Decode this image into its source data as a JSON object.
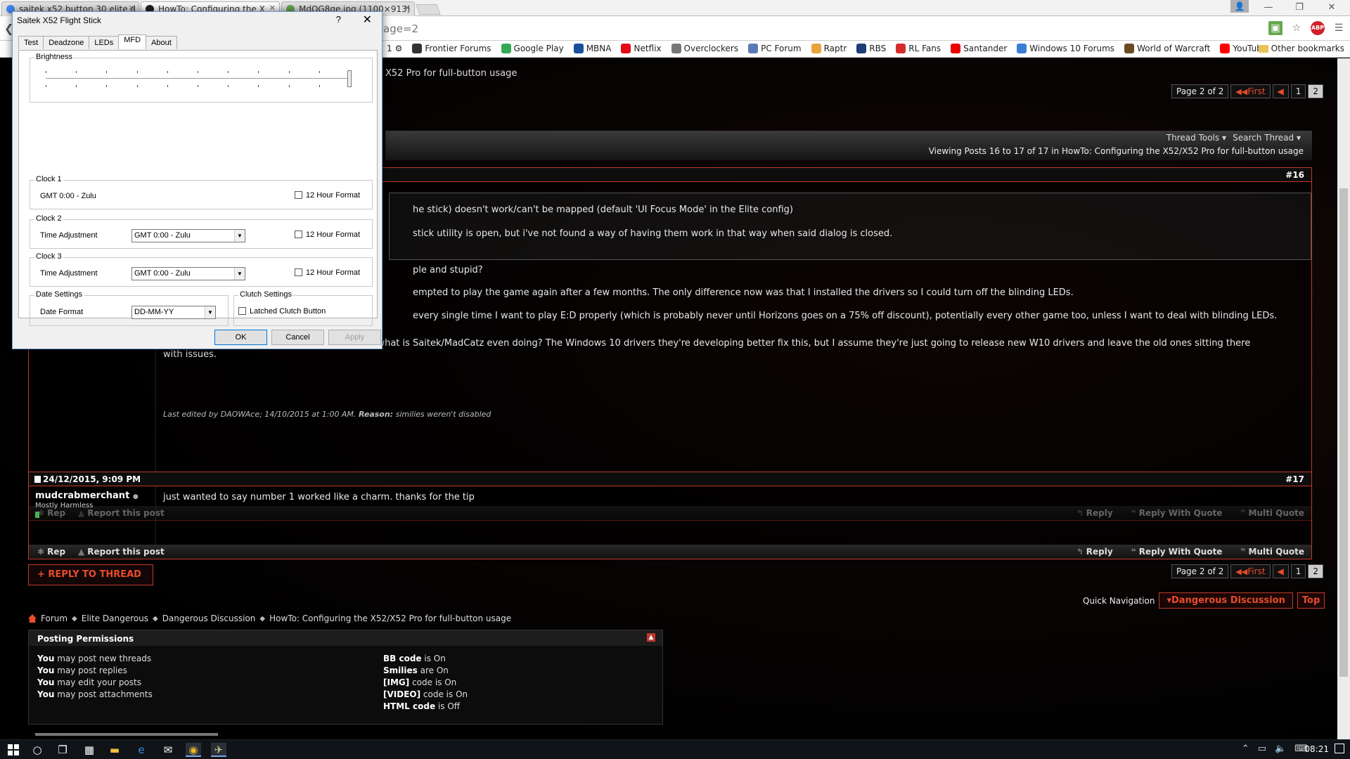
{
  "tabs": [
    {
      "title": "saitek x52 button 30 elite d",
      "color": "#4285f4"
    },
    {
      "title": "HowTo: Configuring the X",
      "color": "#222222"
    },
    {
      "title": "MdOG8ge.jpg (1100×913)",
      "color": "#6aa84f"
    }
  ],
  "url": "age=2",
  "bookmarks": [
    {
      "label": "Frontier Forums",
      "color": "#333333"
    },
    {
      "label": "Google Play",
      "color": "#34a853"
    },
    {
      "label": "MBNA",
      "color": "#1a4f9c"
    },
    {
      "label": "Netflix",
      "color": "#e50914"
    },
    {
      "label": "Overclockers",
      "color": "#777777"
    },
    {
      "label": "PC Forum",
      "color": "#5b7bb8"
    },
    {
      "label": "Raptr",
      "color": "#e8a33c"
    },
    {
      "label": "RBS",
      "color": "#1d3c78"
    },
    {
      "label": "RL Fans",
      "color": "#d62b2b"
    },
    {
      "label": "Santander",
      "color": "#ec0000"
    },
    {
      "label": "Windows 10 Forums",
      "color": "#3a7fd5"
    },
    {
      "label": "World of Warcraft",
      "color": "#6b4b21"
    },
    {
      "label": "YouTube",
      "color": "#ff0000"
    }
  ],
  "bookmark_prefix": "1",
  "other_bookmarks": "Other bookmarks",
  "forum": {
    "thread_title_partial": "X52 Pro for full-button usage",
    "pager": {
      "label": "Page 2 of 2",
      "first": "First",
      "pages": [
        "1",
        "2"
      ],
      "current": "2"
    },
    "thread_tools": "Thread Tools",
    "search_thread": "Search Thread",
    "viewing": "Viewing Posts 16 to 17 of 17 in HowTo: Configuring the X52/X52 Pro for full-button usage",
    "post16": {
      "number": "#16",
      "line1": "he stick) doesn't work/can't be mapped (default 'UI Focus Mode' in the Elite config)",
      "line2": "stick utility is open, but i've not found a way of having them work in that way when said dialog is closed.",
      "line3": "ple and stupid?",
      "line4": "empted to play the game again after a few months. The only difference now was that I installed the drivers so I could turn off the blinding LEDs.",
      "line5": "every single time I want to play E:D properly (which is probably never until Horizons goes on a 75% off discount), potentially every other game too, unless I want to deal with blinding LEDs.",
      "line6": "The drivers haven't been updated since 2013, what is Saitek/MadCatz even doing? The Windows 10 drivers they're developing better fix this, but I assume they're just going to release new W10 drivers and leave the old ones sitting there",
      "line7": "with issues.",
      "edited_prefix": "Last edited by DAOWAce; 14/10/2015 at 1:00 AM.",
      "reason_label": "Reason:",
      "reason_text": "similies weren't disabled"
    },
    "post17": {
      "date": "24/12/2015, 9:09 PM",
      "number": "#17",
      "username": "mudcrabmerchant",
      "rank": "Mostly Harmless",
      "text": "just wanted to say number 1 worked like a charm. thanks for the tip"
    },
    "foot": {
      "rep": "Rep",
      "report": "Report this post",
      "reply": "Reply",
      "reply_quote": "Reply With Quote",
      "multi_quote": "Multi Quote"
    },
    "reply_to_thread": "+ REPLY TO THREAD",
    "quick_nav_label": "Quick Navigation",
    "quick_nav_value": "Dangerous Discussion",
    "top": "Top",
    "breadcrumb": [
      "Forum",
      "Elite Dangerous",
      "Dangerous Discussion",
      "HowTo: Configuring the X52/X52 Pro for full-button usage"
    ],
    "permissions": {
      "title": "Posting Permissions",
      "left": [
        {
          "b": "You",
          "t": "may post new threads"
        },
        {
          "b": "You",
          "t": "may post replies"
        },
        {
          "b": "You",
          "t": "may edit your posts"
        },
        {
          "b": "You",
          "t": "may post attachments"
        }
      ],
      "right": [
        {
          "b": "BB code",
          "t": "is On"
        },
        {
          "b": "Smilies",
          "t": "are On"
        },
        {
          "b": "[IMG]",
          "t": "code is On"
        },
        {
          "b": "[VIDEO]",
          "t": "code is On"
        },
        {
          "b": "HTML code",
          "t": "is Off"
        }
      ]
    }
  },
  "dialog": {
    "title": "Saitek X52 Flight Stick",
    "help": "?",
    "close": "✕",
    "tabs": [
      "Test",
      "Deadzone",
      "LEDs",
      "MFD",
      "About"
    ],
    "active_tab": "MFD",
    "brightness": {
      "label": "Brightness",
      "value": 1.0
    },
    "clock1": {
      "label": "Clock 1",
      "value": "GMT  0:00 - Zulu",
      "hour12": "12 Hour Format"
    },
    "clock2": {
      "label": "Clock 2",
      "adj": "Time Adjustment",
      "value": "GMT  0:00 - Zulu",
      "hour12": "12 Hour Format"
    },
    "clock3": {
      "label": "Clock 3",
      "adj": "Time Adjustment",
      "value": "GMT  0:00 - Zulu",
      "hour12": "12 Hour Format"
    },
    "date": {
      "label": "Date Settings",
      "format_label": "Date Format",
      "format_value": "DD-MM-YY"
    },
    "clutch": {
      "label": "Clutch Settings",
      "latched": "Latched Clutch Button"
    },
    "buttons": {
      "ok": "OK",
      "cancel": "Cancel",
      "apply": "Apply"
    }
  },
  "taskbar": {
    "time": "08:21"
  }
}
